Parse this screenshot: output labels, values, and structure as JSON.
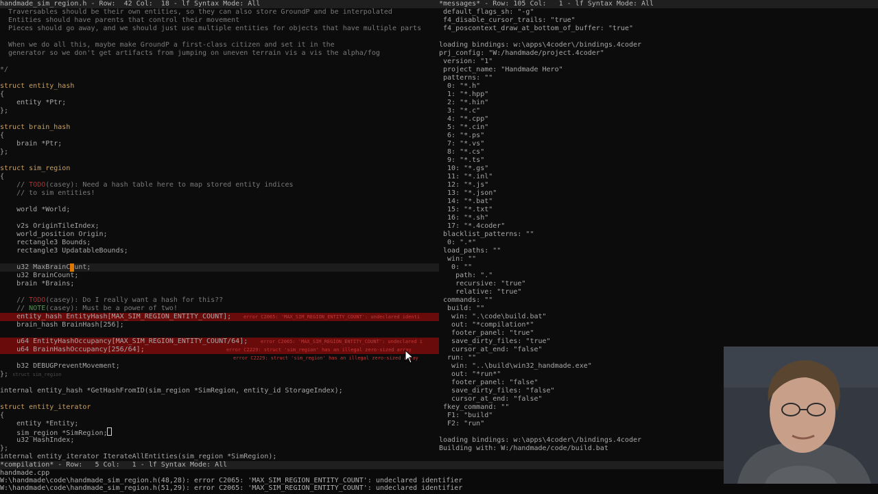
{
  "left_pane": {
    "file_bar": "handmade_sim_region.h - Row:  42 Col:  18 - lf Syntax Mode: All",
    "lines": [
      "  Traversables should be their own entities, so they can also store GroundP and be interpolated",
      "  Entities should have parents that control their movement",
      "  Pieces should go away, and we should just use multiple entities for objects that have multiple parts",
      "",
      "  When we do all this, maybe make GroundP a first-class citizen and set it in the",
      "  generator so we don't get artifacts from jumping on uneven terrain vis a vis the alpha/fog",
      "",
      "*/",
      "",
      "struct entity_hash",
      "{",
      "    entity *Ptr;",
      "};",
      "",
      "struct brain_hash",
      "{",
      "    brain *Ptr;",
      "};",
      "",
      "struct sim_region",
      "{",
      "    // TODO(casey): Need a hash table here to map stored entity indices",
      "    // to sim entities!",
      "",
      "    world *World;",
      "",
      "    v2s OriginTileIndex;",
      "    world_position Origin;",
      "    rectangle3 Bounds;",
      "    rectangle3 UpdatableBounds;",
      "",
      "    u32 MaxBrainCount;",
      "    u32 BrainCount;",
      "    brain *Brains;",
      "",
      "    // TODO(casey): Do I really want a hash for this??",
      "    // NOTE(casey): Must be a power of two!",
      "    entity_hash EntityHash[MAX_SIM_REGION_ENTITY_COUNT];",
      "    brain_hash BrainHash[256];",
      "",
      "    u64 EntityHashOccupancy[MAX_SIM_REGION_ENTITY_COUNT/64];",
      "    u64 BrainHashOccupancy[256/64];",
      "",
      "    b32 DEBUGPreventMovement;",
      "};",
      "",
      "internal entity_hash *GetHashFromID(sim_region *SimRegion, entity_id StorageIndex);",
      "",
      "struct entity_iterator",
      "{",
      "    entity *Entity;",
      "    sim_region *SimRegion;",
      "    u32 HashIndex;",
      "};",
      "internal entity_iterator IterateAllEntities(sim_region *SimRegion);"
    ],
    "inline_errors": {
      "e1": "error C2065: 'MAX_SIM_REGION_ENTITY_COUNT': undeclared identi",
      "e2": "error C2065: 'MAX_SIM_REGION_ENTITY_COUNT': undeclared i",
      "e3": "error C2229: struct 'sim_region' has an illegal zero-sized array",
      "e4": "error C2229: struct 'sim_region' has an illegal zero-sized array",
      "struct_end_hint": "struct sim_region"
    }
  },
  "right_pane": {
    "file_bar": "*messages* - Row: 105 Col:   1 - lf Syntax Mode: All",
    "lines": [
      " default_flags_sh: \"-g\"",
      " f4_disable_cursor_trails: \"true\"",
      " f4_poscontext_draw_at_bottom_of_buffer: \"true\"",
      "",
      "loading bindings: w:\\apps\\4coder\\/bindings.4coder",
      "prj_config: \"W:/handmade/project.4coder\"",
      " version: \"1\"",
      " project_name: \"Handmade Hero\"",
      " patterns: \"\"",
      "  0: \"*.h\"",
      "  1: \"*.hpp\"",
      "  2: \"*.hin\"",
      "  3: \"*.c\"",
      "  4: \"*.cpp\"",
      "  5: \"*.cin\"",
      "  6: \"*.ps\"",
      "  7: \"*.vs\"",
      "  8: \"*.cs\"",
      "  9: \"*.ts\"",
      "  10: \"*.gs\"",
      "  11: \"*.inl\"",
      "  12: \"*.js\"",
      "  13: \"*.json\"",
      "  14: \"*.bat\"",
      "  15: \"*.txt\"",
      "  16: \"*.sh\"",
      "  17: \"*.4coder\"",
      " blacklist_patterns: \"\"",
      "  0: \".*\"",
      " load_paths: \"\"",
      "  win: \"\"",
      "   0: \"\"",
      "    path: \".\"",
      "    recursive: \"true\"",
      "    relative: \"true\"",
      " commands: \"\"",
      "  build: \"\"",
      "   win: \".\\code\\build.bat\"",
      "   out: \"*compilation*\"",
      "   footer_panel: \"true\"",
      "   save_dirty_files: \"true\"",
      "   cursor_at_end: \"false\"",
      "  run: \"\"",
      "   win: \"..\\build\\win32_handmade.exe\"",
      "   out: \"*run*\"",
      "   footer_panel: \"false\"",
      "   save_dirty_files: \"false\"",
      "   cursor_at_end: \"false\"",
      " fkey_command: \"\"",
      "  F1: \"build\"",
      "  F2: \"run\"",
      "",
      "loading bindings: w:\\apps\\4coder\\/bindings.4coder",
      "Building with: W:/handmade/code/build.bat",
      ""
    ]
  },
  "compilation": {
    "file_bar": "*compilation* - Row:   5 Col:   1 - lf Syntax Mode: All",
    "lines": [
      "handmade.cpp",
      "W:\\handmade\\code\\handmade_sim_region.h(48,28): error C2065: 'MAX_SIM_REGION_ENTITY_COUNT': undeclared identifier",
      "W:\\handmade\\code\\handmade_sim_region.h(51,29): error C2065: 'MAX_SIM_REGION_ENTITY_COUNT': undeclared identifier"
    ]
  },
  "colors": {
    "background": "#0c0c0c",
    "text": "#a8a8a8",
    "keyword": "#c8a064",
    "comment": "#7a7a7a",
    "todo": "#b03030",
    "note": "#4a9a4a",
    "error_line": "#6a0b0b",
    "cursor": "#e07800"
  }
}
